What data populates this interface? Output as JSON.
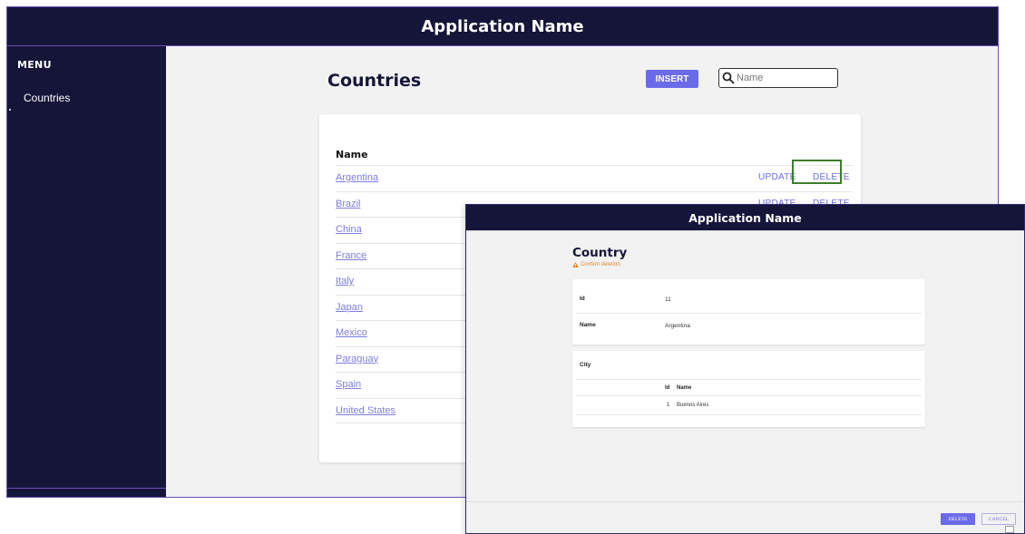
{
  "back_window": {
    "header_title": "Application Name",
    "sidebar": {
      "title": "MENU",
      "items": [
        {
          "label": "Countries"
        }
      ]
    },
    "page_title": "Countries",
    "insert_label": "INSERT",
    "search": {
      "placeholder": "Name",
      "value": ""
    },
    "table": {
      "column_header": "Name",
      "rows": [
        {
          "name": "Argentina",
          "update": "UPDATE",
          "delete": "DELETE"
        },
        {
          "name": "Brazil",
          "update": "UPDATE",
          "delete": "DELETE"
        },
        {
          "name": "China"
        },
        {
          "name": "France"
        },
        {
          "name": "Italy"
        },
        {
          "name": "Japan"
        },
        {
          "name": "Mexico"
        },
        {
          "name": "Paraguay"
        },
        {
          "name": "Spain"
        },
        {
          "name": "United States"
        }
      ]
    }
  },
  "front_window": {
    "header_title": "Application Name",
    "title": "Country",
    "warning": "Confirm deletion.",
    "fields": [
      {
        "label": "Id",
        "value": "11"
      },
      {
        "label": "Name",
        "value": "Argentina"
      }
    ],
    "city": {
      "label": "City",
      "columns": [
        "Id",
        "Name"
      ],
      "rows": [
        {
          "id": "1",
          "name": "Buenos Aires"
        }
      ]
    },
    "buttons": {
      "delete": "DELETE",
      "cancel": "CANCEL"
    }
  },
  "colors": {
    "header_bg": "#15153a",
    "accent": "#6b6bea",
    "link": "#7d7de0",
    "highlight_box": "#3f7d2c",
    "warning": "#e08a2b"
  },
  "icons": [
    "search-icon",
    "warning-icon"
  ]
}
